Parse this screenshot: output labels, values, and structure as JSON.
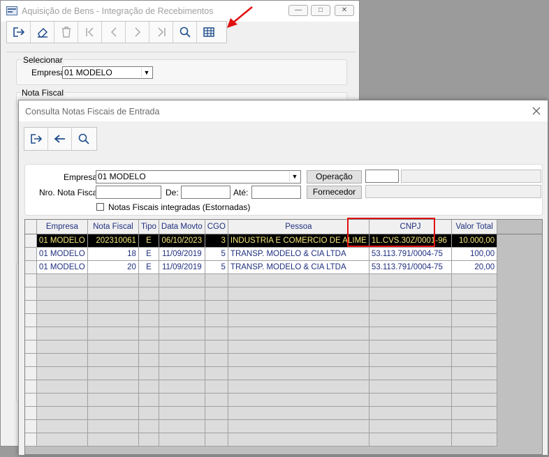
{
  "back_window": {
    "title": "Aquisição de Bens - Integração de Recebimentos",
    "toolbar_icons": [
      "exit-icon",
      "eraser-icon",
      "trash-icon",
      "first-icon",
      "prev-icon",
      "next-icon",
      "last-icon",
      "search-icon",
      "table-icon"
    ],
    "select_group": {
      "label": "Selecionar",
      "empresa_label": "Empresa",
      "empresa_value": "01 MODELO"
    },
    "nota_group": {
      "label": "Nota Fiscal"
    }
  },
  "dialog": {
    "title": "Consulta Notas Fiscais de Entrada",
    "filters": {
      "empresa_label": "Empresa",
      "empresa_value": "01 MODELO",
      "nro_label": "Nro. Nota Fiscal",
      "de_label": "De:",
      "ate_label": "Até:",
      "operacao_button": "Operação",
      "fornecedor_button": "Fornecedor",
      "checkbox_label": "Notas Fiscais integradas (Estornadas)"
    },
    "grid": {
      "columns": [
        "Empresa",
        "Nota Fiscal",
        "Tipo",
        "Data Movto",
        "CGO",
        "Pessoa",
        "CNPJ",
        "Valor Total"
      ],
      "rows": [
        [
          "01 MODELO",
          "202310061",
          "E",
          "06/10/2023",
          "3",
          "INDUSTRIA E COMERCIO DE ALIME",
          "1L.CVS.30Z/0001-96",
          "10.000,00"
        ],
        [
          "01 MODELO",
          "18",
          "E",
          "11/09/2019",
          "5",
          "TRANSP. MODELO & CIA LTDA",
          "53.113.791/0004-75",
          "100,00"
        ],
        [
          "01 MODELO",
          "20",
          "E",
          "11/09/2019",
          "5",
          "TRANSP. MODELO & CIA LTDA",
          "53.113.791/0004-75",
          "20,00"
        ]
      ]
    }
  },
  "colors": {
    "selected_row_bg": "#000000",
    "selected_row_text": "#f6e87a",
    "highlight": "#e01010",
    "arrow": "#e01010"
  }
}
